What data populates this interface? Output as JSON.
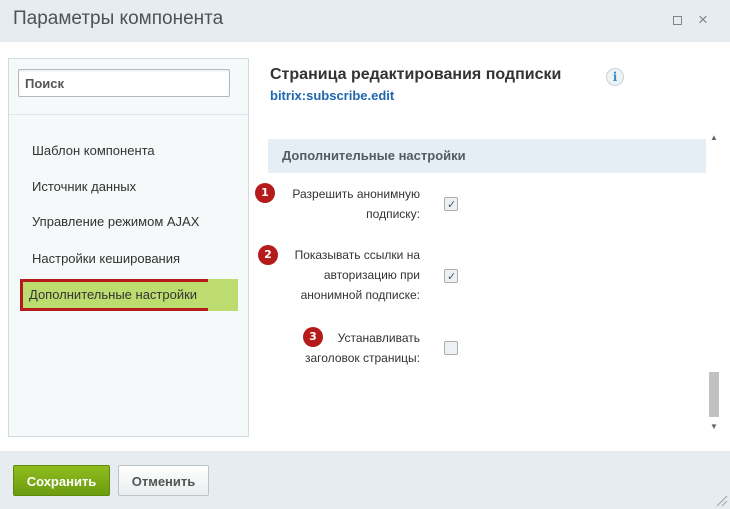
{
  "window": {
    "title": "Параметры компонента",
    "maximize_icon": "maximize-icon",
    "close_icon": "close-icon",
    "close_glyph": "×"
  },
  "sidebar": {
    "search_placeholder": "Поиск",
    "items": [
      {
        "label": "Шаблон компонента"
      },
      {
        "label": "Источник данных"
      },
      {
        "label": "Управление режимом AJAX"
      },
      {
        "label": "Настройки кеширования"
      },
      {
        "label": "Дополнительные настройки",
        "active": true
      }
    ]
  },
  "main": {
    "title": "Страница редактирования подписки",
    "info_glyph": "i",
    "code_name": "bitrix:subscribe.edit",
    "section_title": "Дополнительные настройки",
    "options": [
      {
        "badge": "1",
        "label_lines": [
          "Разрешить анонимную",
          "подписку:"
        ],
        "checked": true
      },
      {
        "badge": "2",
        "label_lines": [
          "Показывать ссылки на",
          "авторизацию при",
          "анонимной подписке:"
        ],
        "checked": true
      },
      {
        "badge": "3",
        "label_lines": [
          "Устанавливать",
          "заголовок страницы:"
        ],
        "checked": false
      }
    ]
  },
  "footer": {
    "save_label": "Сохранить",
    "cancel_label": "Отменить"
  },
  "colors": {
    "accent_green": "#bddc6f",
    "badge_red": "#b51b1b",
    "link_blue": "#2067b0",
    "save_green": "#7cad16"
  }
}
